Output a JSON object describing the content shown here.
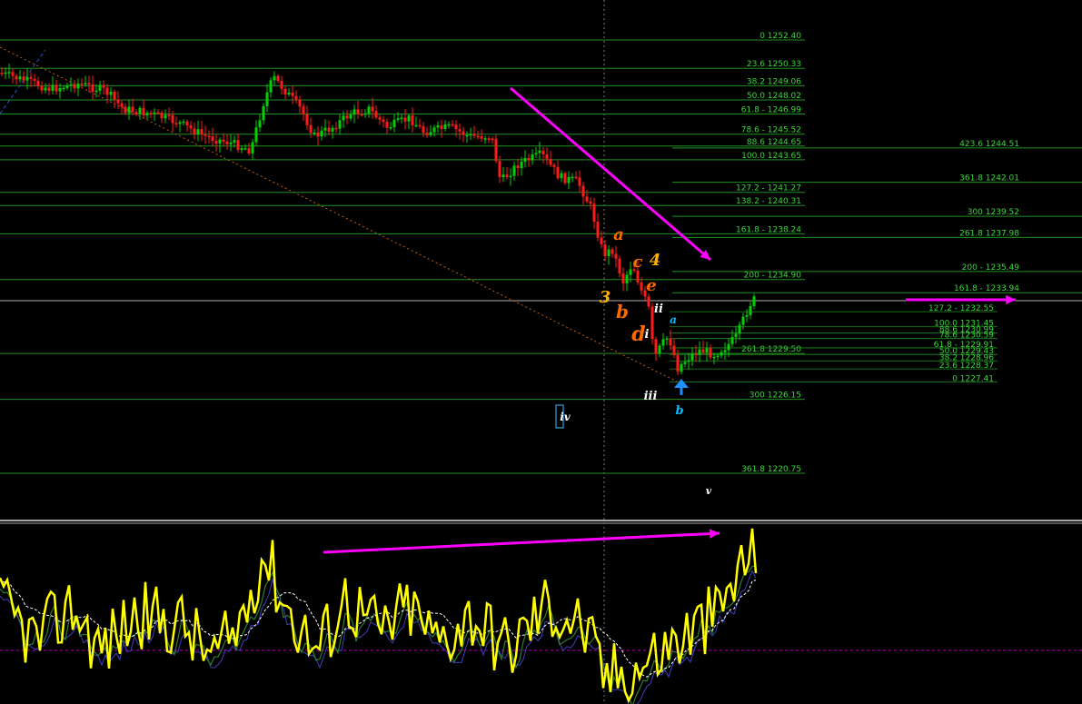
{
  "chart_data": {
    "type": "candlestick",
    "colors": {
      "background": "#000000",
      "fib_line": "#1f8f1f",
      "fib_label": "#3ad63a",
      "bull_candle": "#00d000",
      "bear_candle": "#ff1a1a",
      "annotation_arrow": "#ff00ff",
      "oscillator_main": "#ffff00",
      "oscillator_signal": "#2e7d32",
      "oscillator_signal2": "#3f3fbf",
      "oscillator_avg": "#ffffff",
      "oscillator_level": "#b000b0",
      "wave_orange": "#ff6a00",
      "wave_yellow": "#ffb000",
      "wave_white": "#ffffff",
      "wave_cyan": "#00bfff",
      "current_price_line": "#b0b0b0"
    },
    "price_axis": {
      "ylim": [
        1218.7,
        1253.8
      ]
    },
    "fib_levels_left": [
      {
        "label": "0 1252.40",
        "price": 1252.4
      },
      {
        "label": "23.6 1250.33",
        "price": 1250.33
      },
      {
        "label": "38.2 1249.06",
        "price": 1249.06
      },
      {
        "label": "50.0 1248.02",
        "price": 1248.02
      },
      {
        "label": "61.8 - 1246.99",
        "price": 1246.99
      },
      {
        "label": "78.6 - 1245.52",
        "price": 1245.52
      },
      {
        "label": "88.6 1244.65",
        "price": 1244.65
      },
      {
        "label": "100.0 1243.65",
        "price": 1243.65
      },
      {
        "label": "127.2 - 1241.27",
        "price": 1241.27
      },
      {
        "label": "138.2 - 1240.31",
        "price": 1240.31
      },
      {
        "label": "161.8 - 1238.24",
        "price": 1238.24
      },
      {
        "label": "200 - 1234.90",
        "price": 1234.9
      },
      {
        "label": "261.8 1229.50",
        "price": 1229.5
      },
      {
        "label": "300 1226.15",
        "price": 1226.15
      },
      {
        "label": "361.8 1220.75",
        "price": 1220.75
      }
    ],
    "fib_levels_right": [
      {
        "label": "423.6 1244.51",
        "price": 1244.51
      },
      {
        "label": "361.8 1242.01",
        "price": 1242.01
      },
      {
        "label": "300 1239.52",
        "price": 1239.52
      },
      {
        "label": "261.8 1237.98",
        "price": 1237.98
      },
      {
        "label": "200 - 1235.49",
        "price": 1235.49
      },
      {
        "label": "161.8 - 1233.94",
        "price": 1233.94
      }
    ],
    "fib_levels_small": [
      {
        "label": "127.2 - 1232.55",
        "price": 1232.55
      },
      {
        "label": "100.0 1231.45",
        "price": 1231.45
      },
      {
        "label": "88.6 1230.99",
        "price": 1230.99
      },
      {
        "label": "78.6 1230.59",
        "price": 1230.59
      },
      {
        "label": "61.8 - 1229.91",
        "price": 1229.91
      },
      {
        "label": "50.0 1229.43",
        "price": 1229.43
      },
      {
        "label": "38.2 1228.96",
        "price": 1228.96
      },
      {
        "label": "23.6 1228.37",
        "price": 1228.37
      },
      {
        "label": "0 1227.41",
        "price": 1227.41
      }
    ],
    "wave_labels": [
      {
        "text": "a",
        "color": "orange"
      },
      {
        "text": "b",
        "color": "orange"
      },
      {
        "text": "c",
        "color": "orange"
      },
      {
        "text": "d",
        "color": "orange"
      },
      {
        "text": "e",
        "color": "orange"
      },
      {
        "text": "3",
        "color": "yellow"
      },
      {
        "text": "4",
        "color": "yellow"
      },
      {
        "text": "ii",
        "color": "white"
      },
      {
        "text": "i",
        "color": "white"
      },
      {
        "text": "iii",
        "color": "white"
      },
      {
        "text": "a",
        "color": "cyan"
      },
      {
        "text": "b",
        "color": "cyan"
      },
      {
        "text": "iv",
        "color": "white"
      },
      {
        "text": "v",
        "color": "white"
      }
    ],
    "oscillator": {
      "ylim": [
        0,
        100
      ],
      "level": 30
    }
  }
}
